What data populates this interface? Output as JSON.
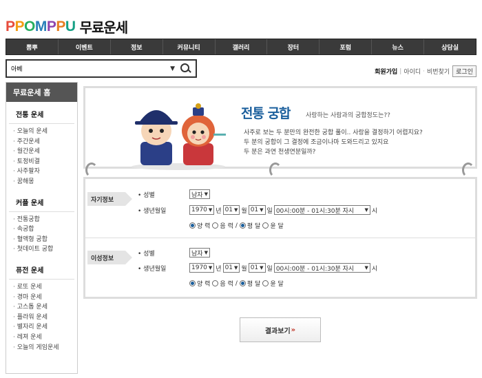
{
  "brand": {
    "logo": "PPOMPPU",
    "title": "무료운세"
  },
  "nav": [
    "뽐뿌",
    "이벤트",
    "정보",
    "커뮤니티",
    "갤러리",
    "장터",
    "포럼",
    "뉴스",
    "상담실"
  ],
  "search": {
    "value": "아베"
  },
  "userlinks": {
    "join": "회원가입",
    "id": "아이디",
    "pw": "비번찾기",
    "login": "로그인"
  },
  "sidebar": {
    "home": "무료운세 홈",
    "sections": [
      {
        "title": "전통 운세",
        "items": [
          "오늘의 운세",
          "주간운세",
          "월간운세",
          "토정비결",
          "사주팔자",
          "꿈해몽"
        ]
      },
      {
        "title": "커플 운세",
        "items": [
          "전통궁합",
          "속궁합",
          "혈액형 궁합",
          "첫데이트 궁합"
        ]
      },
      {
        "title": "퓨전 운세",
        "items": [
          "로또 운세",
          "경마 운세",
          "고스톱 운세",
          "플라워 운세",
          "별자리 운세",
          "레져 운세",
          "오늘의 게임운세"
        ]
      }
    ]
  },
  "banner": {
    "title": "전통 궁합",
    "subtitle": "사랑하는 사람과의 궁합정도는??",
    "lines": [
      "사주로 보는 두 분만의 완전한 궁합 풀이.. 사랑을 결정하기 어렵지요?",
      "두 분의 궁합이 그 결정에 조금이나마 도와드리고 있지요",
      "두 분은 과연 천생연분일까?"
    ]
  },
  "form": {
    "labels": {
      "gender": "성별",
      "birth": "생년월일"
    },
    "units": {
      "year": "년",
      "month": "월",
      "day": "일",
      "hour": "시"
    },
    "radios": {
      "solar": "양 력",
      "lunar": "음 력",
      "slash": "/",
      "normal": "평 달",
      "leap": "윤 달"
    },
    "self": {
      "tag": "자기정보",
      "gender": "남자",
      "year": "1970",
      "month": "01",
      "day": "01",
      "time": "00시:00분 - 01시:30분 자시"
    },
    "other": {
      "tag": "이성정보",
      "gender": "남자",
      "year": "1970",
      "month": "01",
      "day": "01",
      "time": "00시:00분 - 01시:30분 자시"
    }
  },
  "result_button": {
    "label": "결과보기",
    "arrow": "»"
  },
  "colors": {
    "accent": "#1a5e9c",
    "nav_bg": "#3a3a3a",
    "sidebar_head": "#555555"
  }
}
